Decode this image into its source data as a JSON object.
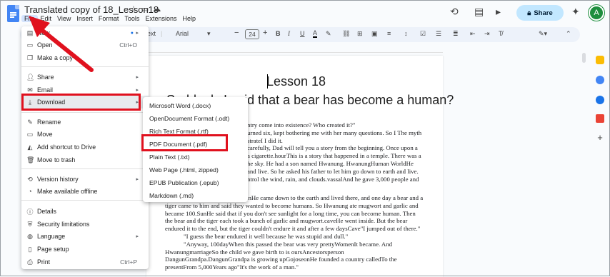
{
  "window": {
    "title": "Translated copy of 18_Lesson18",
    "menu": [
      "File",
      "Edit",
      "View",
      "Insert",
      "Format",
      "Tools",
      "Extensions",
      "Help"
    ],
    "share_label": "Share",
    "avatar_letter": "A"
  },
  "toolbar": {
    "style_fragment": "ext",
    "font": "Arial",
    "font_size": "24"
  },
  "file_menu": {
    "items": [
      {
        "label": "New",
        "icon": "document-icon",
        "shortcut": "",
        "arrow": true
      },
      {
        "label": "Open",
        "icon": "folder-icon",
        "shortcut": "Ctrl+O"
      },
      {
        "label": "Make a copy",
        "icon": "copy-icon",
        "shortcut": ""
      },
      {
        "label": "Share",
        "icon": "share-person-icon",
        "arrow": true
      },
      {
        "label": "Email",
        "icon": "email-icon",
        "arrow": true
      },
      {
        "label": "Download",
        "icon": "download-icon",
        "arrow": true
      },
      {
        "label": "Rename",
        "icon": "pencil-icon"
      },
      {
        "label": "Move",
        "icon": "move-folder-icon"
      },
      {
        "label": "Add shortcut to Drive",
        "icon": "drive-shortcut-icon"
      },
      {
        "label": "Move to trash",
        "icon": "trash-icon"
      },
      {
        "label": "Version history",
        "icon": "history-icon",
        "arrow": true
      },
      {
        "label": "Make available offline",
        "icon": "offline-icon"
      },
      {
        "label": "Details",
        "icon": "info-icon"
      },
      {
        "label": "Security limitations",
        "icon": "security-icon"
      },
      {
        "label": "Language",
        "icon": "globe-icon",
        "arrow": true
      },
      {
        "label": "Page setup",
        "icon": "page-setup-icon"
      },
      {
        "label": "Print",
        "icon": "print-icon",
        "shortcut": "Ctrl+P"
      }
    ]
  },
  "download_menu": {
    "items": [
      "Microsoft Word (.docx)",
      "OpenDocument Format (.odt)",
      "Rich Text Format (.rtf)",
      "PDF Document (.pdf)",
      "Plain Text (.txt)",
      "Web Page (.html, zipped)",
      "EPUB Publication (.epub)",
      "Markdown (.md)"
    ]
  },
  "document": {
    "heading1": "Lesson 18",
    "heading2": "Suddenly I said that a bear has become a human?",
    "lines_top": [
      "ntry come into existence? Who created it?\"",
      "urned six, kept bothering me with her many questions. So I The myth",
      "strateI I did it.",
      "carefully, Dad will tell you a story from the beginning. Once upon a",
      "a cigarette.hourThis is a story that happened in a temple. There was a",
      "he sky. He had a son named Hwanung. HwanungHuman WorldHe",
      "and live. So he asked his father to let him go down to earth and live.",
      "ntrol the wind, rain, and clouds.vassalAnd he gave 3,000 people and"
    ],
    "lines_bottom": [
      "inHe came down to the earth and lived there, and one day a bear and a",
      "tiger came to him and said they wanted to become humans. So Hwanung ate mugwort and garlic and",
      "became 100.SunHe said that if you don't see sunlight for a long time, you can become human. Then",
      "the bear and the tiger each took a bunch of garlic and mugwort.caveHe went inside. But the bear",
      "endured it to the end, but the tiger couldn't endure it and after a few daysCave\"I jumped out of there.\"",
      "\"I guess the bear endured it well because he was stupid and dull.\"",
      "\"Anyway, 100dayWhen this passed the bear was very prettyWomenIt became. And",
      "HwanungmarriageSo the child we gave birth to is oursAncestorsperson",
      "DangunGrandpa.DangunGrandpa is growing upGojoseonHe founded a country calledTo the",
      "presentFrom 5,000Years ago\"It's the work of a man.\""
    ]
  },
  "colors": {
    "accent": "#c2e7ff",
    "highlight_box": "#e0111e",
    "avatar": "#1e8e3e"
  }
}
